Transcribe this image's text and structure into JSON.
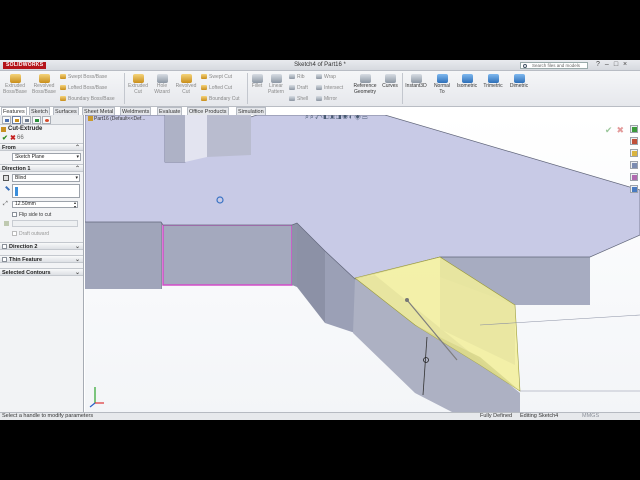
{
  "app": {
    "logo": "SOLIDWORKS",
    "title": "Sketch4 of Part16 *",
    "search_placeholder": "Search files and models",
    "window_controls": [
      "?",
      "–",
      "□",
      "×"
    ]
  },
  "ribbon": {
    "large": [
      {
        "label": "Extruded Boss/Base",
        "icon": "extruded-boss-icon",
        "enabled": false
      },
      {
        "label": "Revolved Boss/Base",
        "icon": "revolved-boss-icon",
        "enabled": false
      },
      {
        "label": "Extruded Cut",
        "icon": "extruded-cut-icon",
        "enabled": false
      },
      {
        "label": "Hole Wizard",
        "icon": "hole-wizard-icon",
        "enabled": false
      },
      {
        "label": "Revolved Cut",
        "icon": "revolved-cut-icon",
        "enabled": false
      },
      {
        "label": "Fillet",
        "icon": "fillet-icon",
        "enabled": false
      },
      {
        "label": "Linear Pattern",
        "icon": "linear-pattern-icon",
        "enabled": false
      },
      {
        "label": "Reference Geometry",
        "icon": "reference-geometry-icon",
        "enabled": true
      },
      {
        "label": "Curves",
        "icon": "curves-icon",
        "enabled": true
      },
      {
        "label": "Instant3D",
        "icon": "instant3d-icon",
        "enabled": true
      },
      {
        "label": "Normal To",
        "icon": "normal-to-icon",
        "enabled": true
      },
      {
        "label": "Isometric",
        "icon": "isometric-icon",
        "enabled": true
      },
      {
        "label": "Trimetric",
        "icon": "trimetric-icon",
        "enabled": true
      },
      {
        "label": "Dimetric",
        "icon": "dimetric-icon",
        "enabled": true
      }
    ],
    "small_boss": [
      "Swept Boss/Base",
      "Lofted Boss/Base",
      "Boundary Boss/Base"
    ],
    "small_cut": [
      "Swept Cut",
      "Lofted Cut",
      "Boundary Cut"
    ],
    "small_features": [
      "Rib",
      "Draft",
      "Shell"
    ],
    "small_more": [
      "Wrap",
      "Intersect",
      "Mirror"
    ]
  },
  "tabs": [
    "Features",
    "Sketch",
    "Surfaces",
    "Sheet Metal",
    "Weldments",
    "Evaluate",
    "Office Products",
    "Simulation"
  ],
  "property_manager": {
    "title": "Cut-Extrude",
    "detail_symbol": "66",
    "from_label": "From",
    "from_value": "Sketch Plane",
    "direction1_label": "Direction 1",
    "end_condition": "Blind",
    "depth": "12.50mm",
    "flip_side_label": "Flip side to cut",
    "draft_label": "Draft outward",
    "direction2_label": "Direction 2",
    "thin_feature_label": "Thin Feature",
    "selected_contours_label": "Selected Contours"
  },
  "viewport": {
    "tree_path": "Part16 (Default<<Def..."
  },
  "status": {
    "message": "Select a handle to modify parameters",
    "defined": "Fully Defined",
    "editing": "Editing Sketch4",
    "units": "MMGS"
  },
  "colors": {
    "model_top": "#c8cae6",
    "model_side": "#9ea3b8",
    "cut_preview": "#f2ef9a",
    "selected_edge": "#d24cc8",
    "accent": "#3a8edb"
  }
}
